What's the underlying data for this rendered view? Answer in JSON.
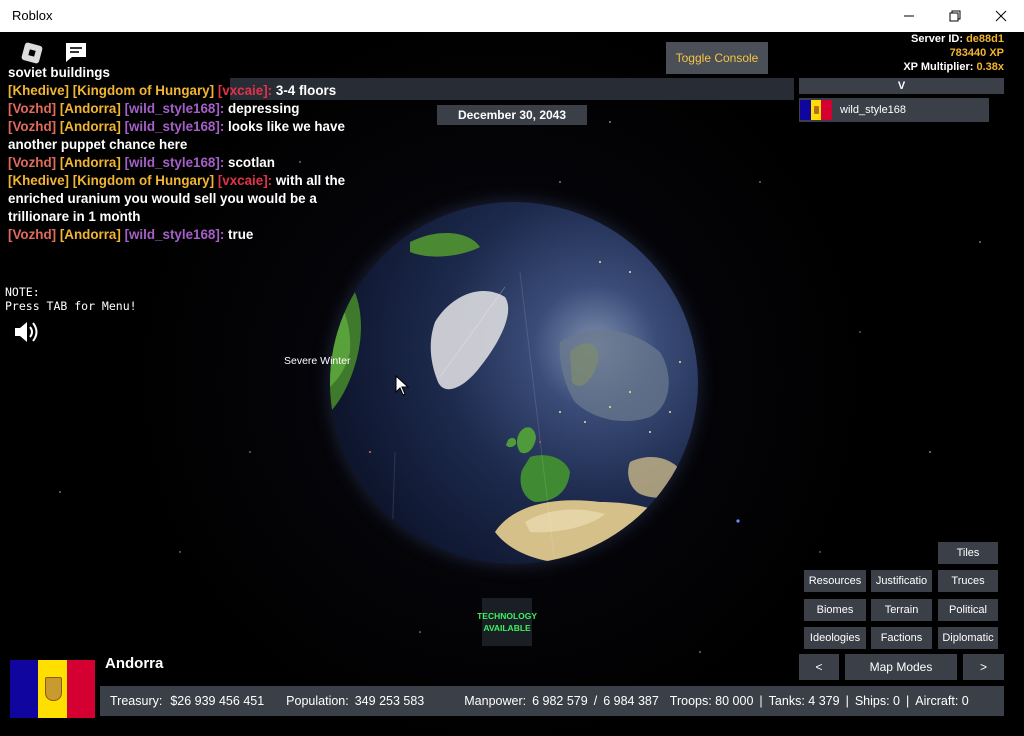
{
  "window": {
    "title": "Roblox"
  },
  "server": {
    "id_label": "Server ID:",
    "id_value": "de88d1",
    "xp": "783440 XP",
    "multiplier_label": "XP Multiplier:",
    "multiplier_value": "0.38x"
  },
  "toggle_console": "Toggle Console",
  "chat": {
    "partial_line": "soviet buildings",
    "messages": [
      {
        "rank": "[Khedive]",
        "country": "[Kingdom of Hungary]",
        "user": "[vxcaie]:",
        "text": "3-4 floors",
        "style": "hungary"
      },
      {
        "rank": "[Vozhd]",
        "country": "[Andorra]",
        "user": "[wild_style168]:",
        "text": "depressing",
        "style": "andorra"
      },
      {
        "rank": "[Vozhd]",
        "country": "[Andorra]",
        "user": "[wild_style168]:",
        "text": "looks like we have another puppet chance here",
        "style": "andorra"
      },
      {
        "rank": "[Vozhd]",
        "country": "[Andorra]",
        "user": "[wild_style168]:",
        "text": "scotlan",
        "style": "andorra"
      },
      {
        "rank": "[Khedive]",
        "country": "[Kingdom of Hungary]",
        "user": "[vxcaie]:",
        "text": "with all the enriched uranium you would sell you would be a trillionare in 1 month",
        "style": "hungary"
      },
      {
        "rank": "[Vozhd]",
        "country": "[Andorra]",
        "user": "[wild_style168]:",
        "text": "true",
        "style": "andorra"
      }
    ]
  },
  "date": "December 30, 2043",
  "player_list": {
    "tab_label": "V",
    "players": [
      {
        "name": "wild_style168"
      }
    ]
  },
  "note": {
    "line1": "NOTE:",
    "line2": "Press TAB for Menu!"
  },
  "weather_label": "Severe Winter",
  "tech_badge": "TECHNOLOGY AVAILABLE",
  "map_modes": {
    "tiles": "Tiles",
    "resources": "Resources",
    "justification": "Justificatio",
    "truces": "Truces",
    "biomes": "Biomes",
    "terrain": "Terrain",
    "political": "Political",
    "ideologies": "Ideologies",
    "factions": "Factions",
    "diplomatic": "Diplomatic",
    "prev": "<",
    "label": "Map Modes",
    "next": ">"
  },
  "country": {
    "name": "Andorra",
    "treasury_label": "Treasury:",
    "treasury": "$26 939 456 451",
    "population_label": "Population:",
    "population": "349 253 583",
    "manpower_label": "Manpower:",
    "manpower": "6 982 579",
    "manpower_max": "6 984 387",
    "troops": "Troops: 80 000",
    "tanks": "Tanks: 4 379",
    "ships": "Ships: 0",
    "aircraft": "Aircraft: 0"
  },
  "colors": {
    "gold": "#f2b531",
    "red_user": "#e0334a",
    "purple_user": "#a55fc8",
    "vozhd": "#e06a5c",
    "tech_green": "#3df05f",
    "panel": "#3a3f48",
    "andorra_blue": "#10069f",
    "andorra_yellow": "#fedf00",
    "andorra_red": "#d50032"
  }
}
